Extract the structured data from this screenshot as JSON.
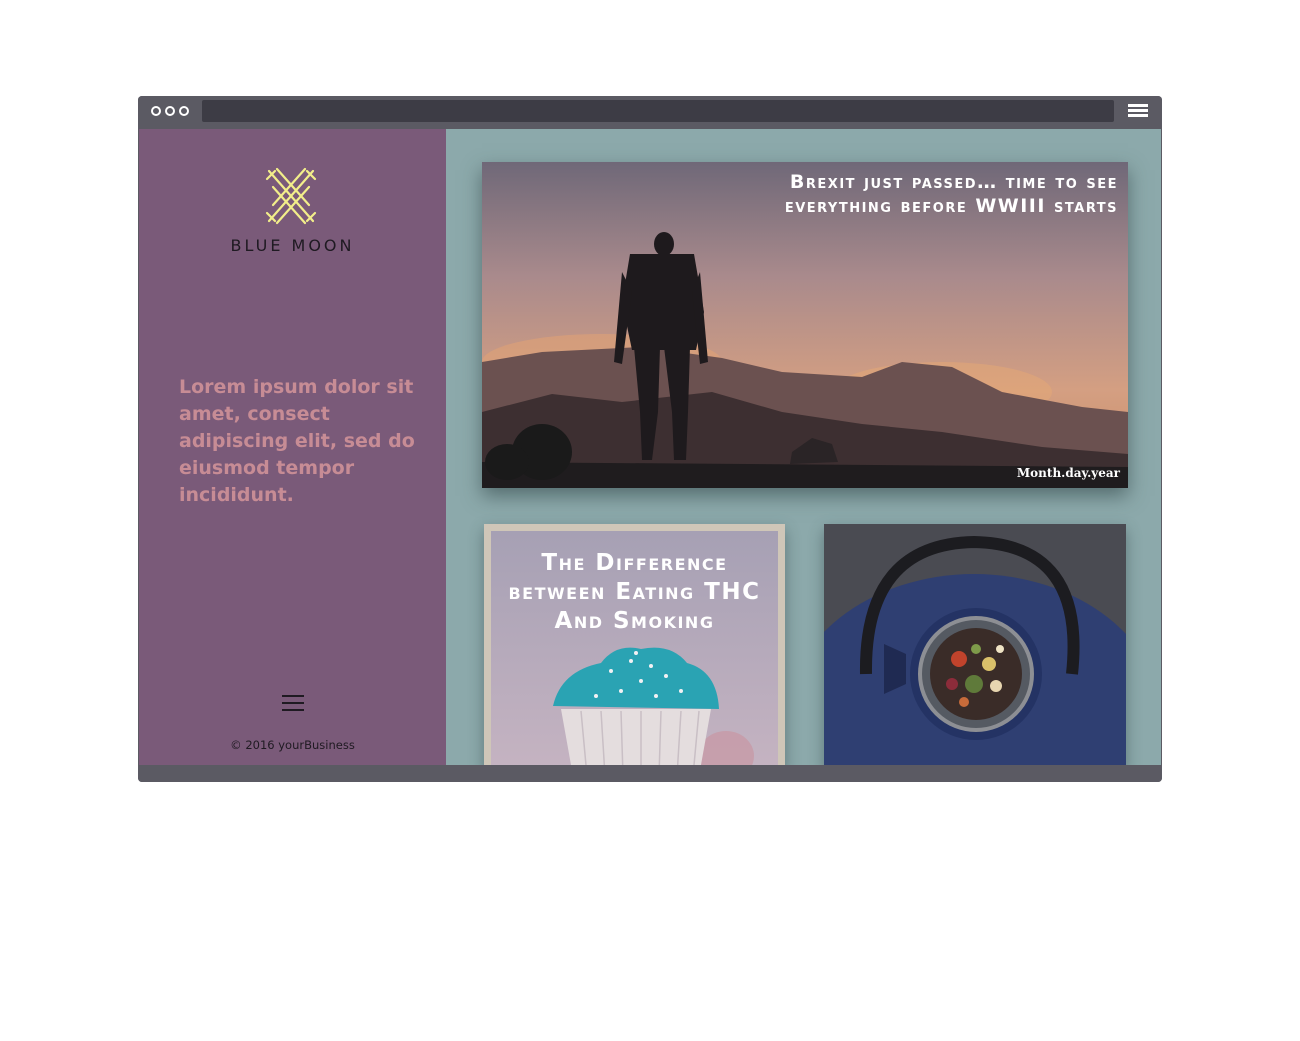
{
  "browser": {
    "window_dots": [
      "dot",
      "dot",
      "dot"
    ],
    "menu_icon": "hamburger-icon"
  },
  "sidebar": {
    "logo_icon": "crosshatch-logo-icon",
    "brand_name": "BLUE MOON",
    "tagline": "Lorem ipsum dolor sit amet, consect adipiscing elit, sed do eiusmod tempor incididunt.",
    "menu_icon": "hamburger-icon",
    "copyright": "© 2016 yourBusiness"
  },
  "featured_post": {
    "title": "Brexit just passed… time to see everything before WWIII starts",
    "date": "Month.day.year"
  },
  "posts": [
    {
      "title": "The Difference between Eating THC And Smoking"
    },
    {
      "title": ""
    }
  ],
  "colors": {
    "sidebar_bg": "#7a5a79",
    "main_bg": "#8ca9ab",
    "tagline": "#c78c95",
    "logo": "#f2ee8a",
    "browser_chrome": "#5b5a63"
  }
}
